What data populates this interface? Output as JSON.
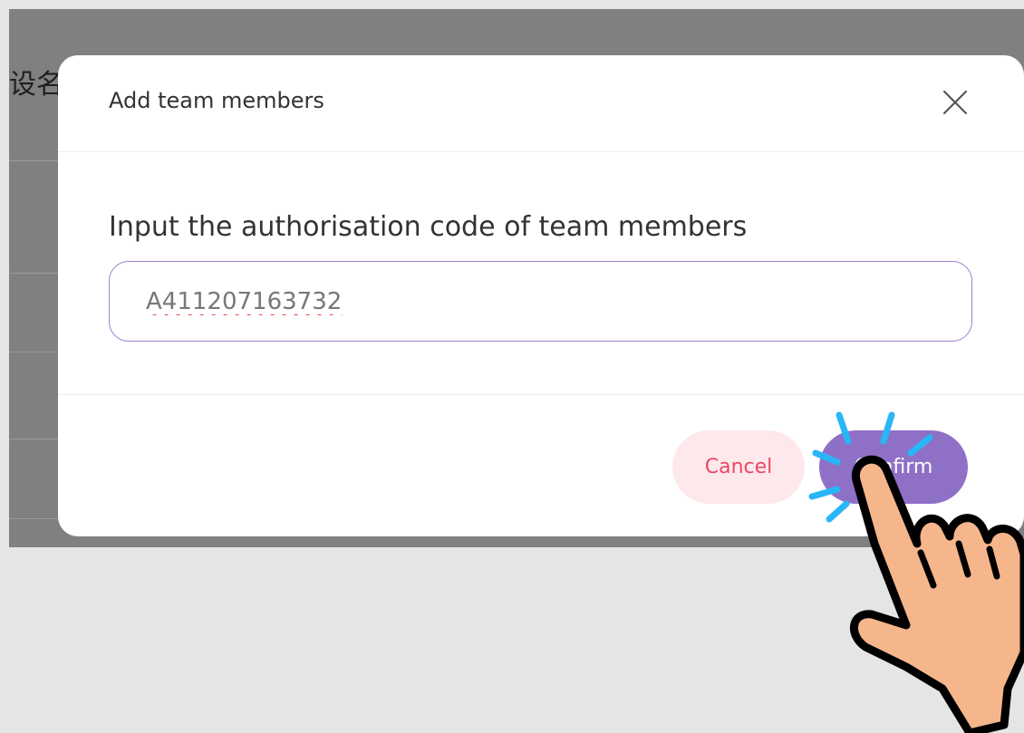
{
  "background": {
    "partial_text": "设名"
  },
  "dialog": {
    "title": "Add team members",
    "close_icon": "close-icon",
    "field_label": "Input the authorisation code of team members",
    "code_value": "A411207163732",
    "cancel_label": "Cancel",
    "confirm_label": "Confirm"
  },
  "colors": {
    "accent": "#8f70c7",
    "cancel_bg": "#fde8ec",
    "cancel_text": "#e84a64",
    "overlay": "#808080",
    "outer_bg": "#e5e5e5",
    "hand_fill": "#f5b68c",
    "tap_lines": "#29b6f6"
  },
  "annotation": {
    "icon": "pointing-hand-icon"
  }
}
